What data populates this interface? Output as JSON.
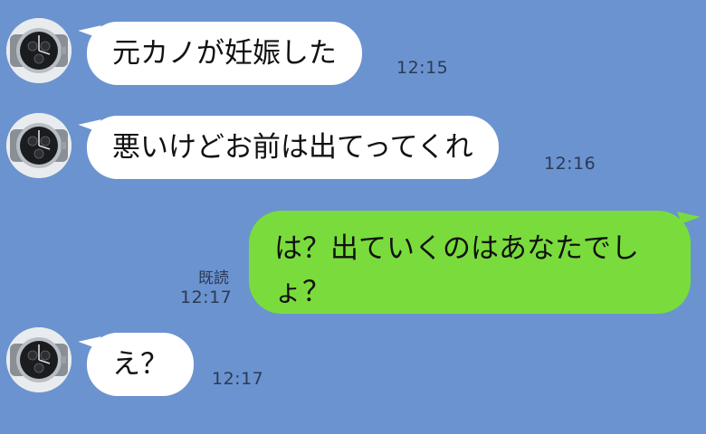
{
  "messages": [
    {
      "sender": "other",
      "text": "元カノが妊娠した",
      "time": "12:15"
    },
    {
      "sender": "other",
      "text": "悪いけどお前は出てってくれ",
      "time": "12:16"
    },
    {
      "sender": "me",
      "text": "は？出ていくのはあなたでしょ？",
      "time": "12:17",
      "read_label": "既読"
    },
    {
      "sender": "other",
      "text": "え？",
      "time": "12:17"
    }
  ],
  "colors": {
    "background": "#6b93cf",
    "incoming_bubble": "#ffffff",
    "outgoing_bubble": "#79dc3c"
  },
  "avatar_icon": "wristwatch-icon"
}
